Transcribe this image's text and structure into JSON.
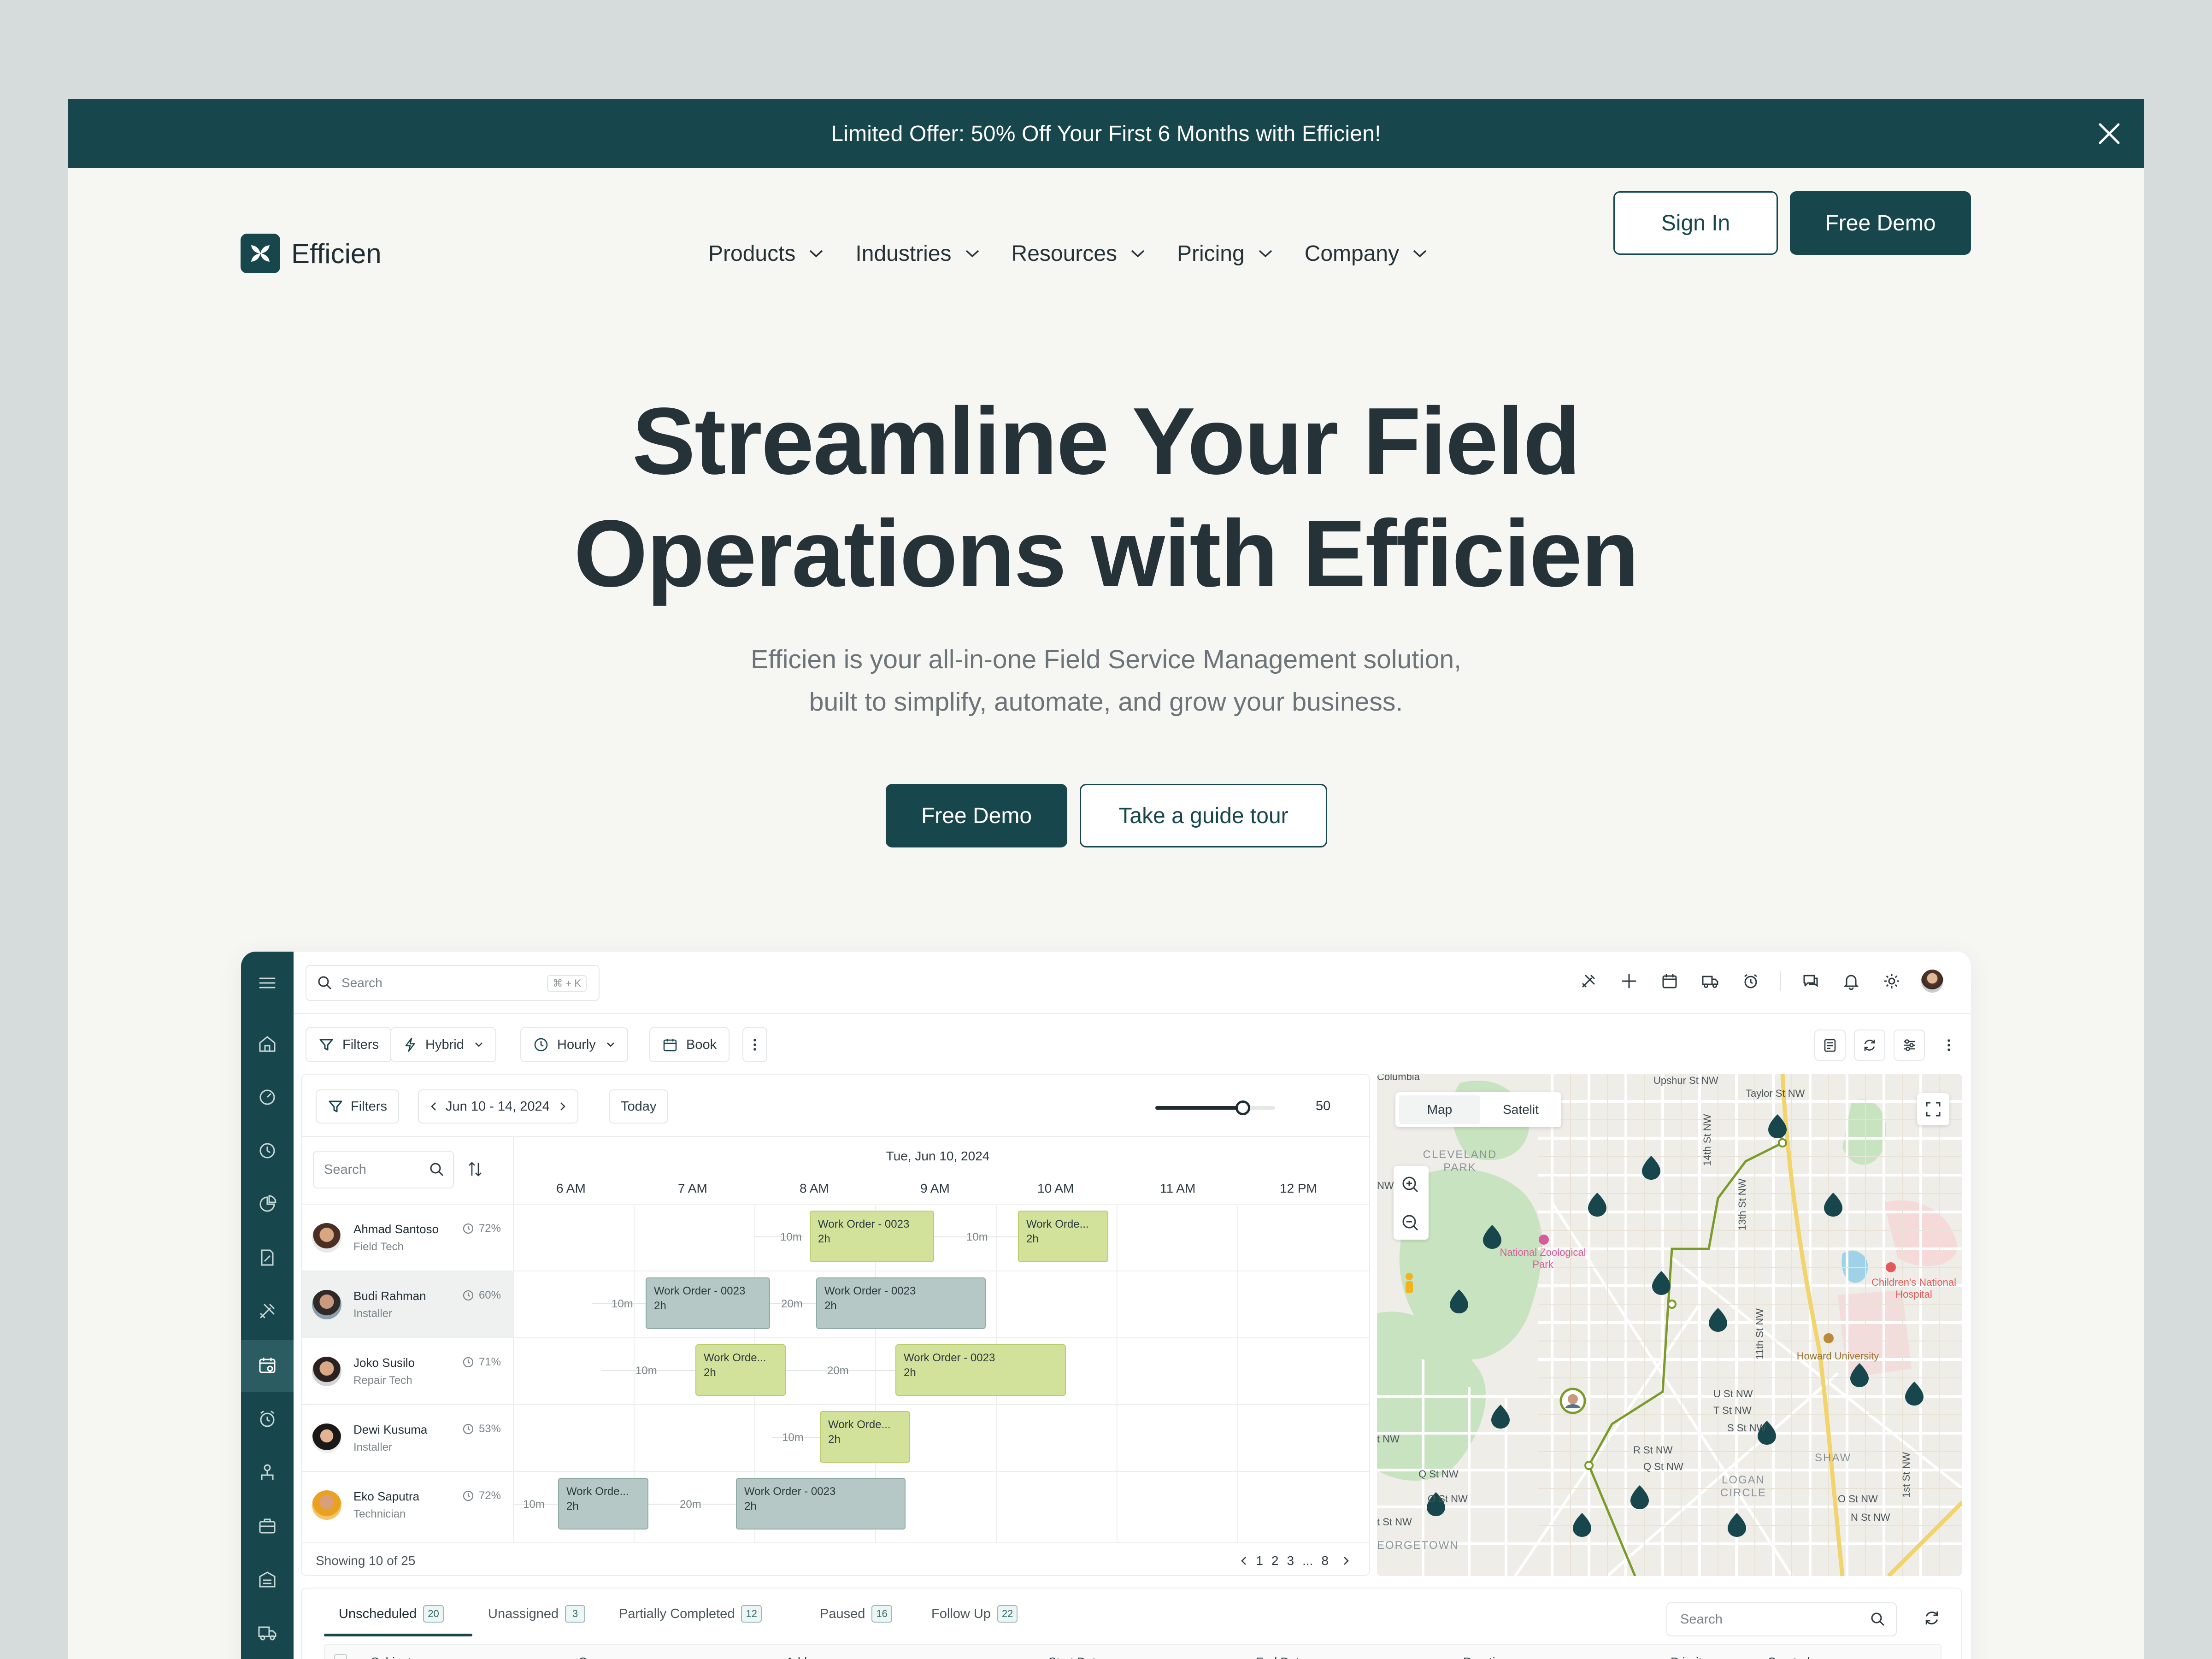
{
  "banner": {
    "text": "Limited Offer: 50% Off Your First 6 Months with Efficien!"
  },
  "brand": {
    "name": "Efficien",
    "color": "#17474d"
  },
  "nav": {
    "items": [
      {
        "label": "Products"
      },
      {
        "label": "Industries"
      },
      {
        "label": "Resources"
      },
      {
        "label": "Pricing"
      },
      {
        "label": "Company"
      }
    ],
    "sign_in": "Sign In",
    "free_demo": "Free Demo"
  },
  "hero": {
    "title_line1": "Streamline Your Field",
    "title_line2": "Operations with Efficien",
    "subtitle_line1": "Efficien is your all-in-one Field Service Management solution,",
    "subtitle_line2": "built to simplify, automate, and grow your business.",
    "primary_cta": "Free Demo",
    "secondary_cta": "Take a guide tour"
  },
  "app": {
    "search_placeholder": "Search",
    "search_shortcut": "⌘ + K",
    "toolbar": {
      "filters": "Filters",
      "mode": "Hybrid",
      "interval": "Hourly",
      "book": "Book"
    },
    "schedule": {
      "filters": "Filters",
      "date_range": "Jun 10 - 14, 2024",
      "today": "Today",
      "zoom_value": "50",
      "zoom_fraction": 0.73,
      "resource_search_placeholder": "Search",
      "date_heading": "Tue, Jun 10, 2024",
      "hours": [
        "6 AM",
        "7 AM",
        "8 AM",
        "9 AM",
        "10 AM",
        "11 AM",
        "12 PM"
      ],
      "resources": [
        {
          "name": "Ahmad Santoso",
          "role": "Field Tech",
          "pct": "72%"
        },
        {
          "name": "Budi Rahman",
          "role": "Installer",
          "pct": "60%"
        },
        {
          "name": "Joko Susilo",
          "role": "Repair Tech",
          "pct": "71%"
        },
        {
          "name": "Dewi Kusuma",
          "role": "Installer",
          "pct": "53%"
        },
        {
          "name": "Eko Saputra",
          "role": "Technician",
          "pct": "72%"
        }
      ],
      "orders": [
        {
          "gap": "10m",
          "title": "Work Order - 0023",
          "duration": "2h"
        },
        {
          "gap": "10m",
          "title": "Work Orde...",
          "duration": "2h"
        },
        {
          "gap": "10m",
          "title": "Work Order - 0023",
          "duration": "2h"
        },
        {
          "gap": "20m",
          "title": "Work Order - 0023",
          "duration": "2h"
        },
        {
          "gap": "10m",
          "title": "Work Orde...",
          "duration": "2h"
        },
        {
          "gap": "20m",
          "title": "Work Order - 0023",
          "duration": "2h"
        },
        {
          "gap": "10m",
          "title": "Work Orde...",
          "duration": "2h"
        },
        {
          "gap": "10m",
          "title": "Work Orde...",
          "duration": "2h"
        },
        {
          "gap": "20m",
          "title": "Work Order - 0023",
          "duration": "2h"
        }
      ],
      "showing": "Showing 10 of 25",
      "pages": [
        "1",
        "2",
        "3",
        "...",
        "8"
      ]
    },
    "map": {
      "mode_map": "Map",
      "mode_satellite": "Satelit",
      "streets": [
        "Upshur St NW",
        "Taylor St NW",
        "14th St NW",
        "13th St NW",
        "11th St NW",
        "1st St NW",
        "U St NW",
        "T St NW",
        "S St NW",
        "R St NW",
        "Q St NW",
        "O St NW",
        "N St NW",
        "Q St NW",
        "O St NW",
        "t NW",
        "t St NW",
        "NW",
        "Columbia"
      ],
      "areas": [
        "CLEVELAND PARK",
        "SHAW",
        "LOGAN CIRCLE",
        "EORGETOWN"
      ],
      "pois": [
        "National Zoological Park",
        "Children's National Hospital",
        "Howard University"
      ]
    },
    "bottom": {
      "tabs": [
        {
          "label": "Unscheduled",
          "count": "20"
        },
        {
          "label": "Unassigned",
          "count": "3"
        },
        {
          "label": "Partially Completed",
          "count": "12"
        },
        {
          "label": "Paused",
          "count": "16"
        },
        {
          "label": "Follow Up",
          "count": "22"
        }
      ],
      "search_placeholder": "Search",
      "columns": [
        "Subject",
        "Company",
        "Address",
        "Start Date",
        "End Date",
        "Duration",
        "Priority",
        "Created on"
      ]
    }
  }
}
